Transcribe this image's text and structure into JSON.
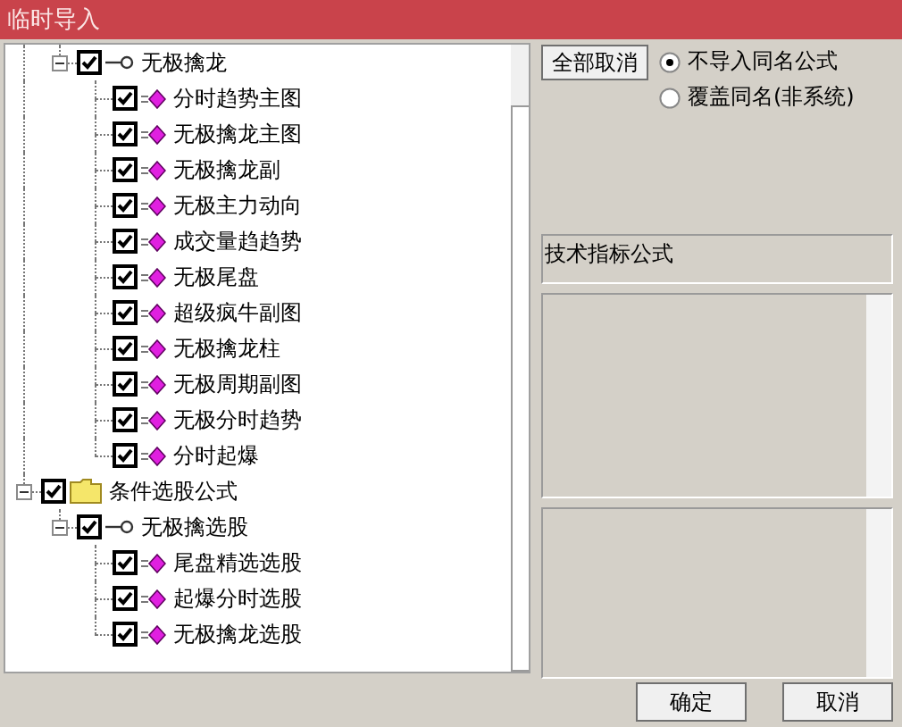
{
  "window": {
    "title": "临时导入"
  },
  "tree": {
    "continued_branch": [
      {
        "label": "无极擒龙",
        "kind": "group",
        "checked": true,
        "expanded": true,
        "children": [
          {
            "label": "分时趋势主图",
            "kind": "formula",
            "checked": true
          },
          {
            "label": "无极擒龙主图",
            "kind": "formula",
            "checked": true
          },
          {
            "label": "无极擒龙副",
            "kind": "formula",
            "checked": true
          },
          {
            "label": "无极主力动向",
            "kind": "formula",
            "checked": true
          },
          {
            "label": "成交量趋趋势",
            "kind": "formula",
            "checked": true
          },
          {
            "label": "无极尾盘",
            "kind": "formula",
            "checked": true
          },
          {
            "label": "超级疯牛副图",
            "kind": "formula",
            "checked": true
          },
          {
            "label": "无极擒龙柱",
            "kind": "formula",
            "checked": true
          },
          {
            "label": "无极周期副图",
            "kind": "formula",
            "checked": true
          },
          {
            "label": "无极分时趋势",
            "kind": "formula",
            "checked": true
          },
          {
            "label": "分时起爆",
            "kind": "formula",
            "checked": true
          }
        ]
      }
    ],
    "items": [
      {
        "label": "条件选股公式",
        "kind": "folder",
        "checked": true,
        "expanded": true,
        "children": [
          {
            "label": "无极擒选股",
            "kind": "group",
            "checked": true,
            "expanded": true,
            "children": [
              {
                "label": "尾盘精选选股",
                "kind": "formula",
                "checked": true
              },
              {
                "label": "起爆分时选股",
                "kind": "formula",
                "checked": true
              },
              {
                "label": "无极擒龙选股",
                "kind": "formula",
                "checked": true
              }
            ]
          }
        ]
      }
    ]
  },
  "cancel_all_button": "全部取消",
  "import_options": [
    {
      "label": "不导入同名公式",
      "selected": true
    },
    {
      "label": "覆盖同名(非系统)",
      "selected": false
    }
  ],
  "formula_type": "技术指标公式",
  "buttons": [
    "确定",
    "取消"
  ]
}
